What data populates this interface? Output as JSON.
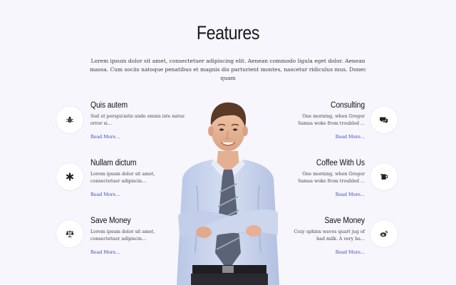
{
  "section": {
    "title": "Features",
    "intro": "Lorem ipsum dolor sit amet, consectetuer adipiscing elit. Aenean commodo ligula eget dolor. Aenean massa. Cum sociis natoque penatibus et magnis dis parturient montes, nascetur ridiculus mus. Donec quam"
  },
  "features_left": [
    {
      "title": "Quis autem",
      "text": "Sed ut perspiciatis unde omnis iste natus error si...",
      "link": "Read More...",
      "icon": "bug-icon"
    },
    {
      "title": "Nullam dictum",
      "text": "Lorem ipsum dolor sit amet, consectetuer adipiscin...",
      "link": "Read More...",
      "icon": "asterisk-icon"
    },
    {
      "title": "Save Money",
      "text": "Lorem ipsum dolor sit amet, consectetuer adipiscin...",
      "link": "Read More...",
      "icon": "balance-scale-icon"
    }
  ],
  "features_right": [
    {
      "title": "Consulting",
      "text": "One morning, when Gregor Samsa woke from troubled ...",
      "link": "Read More...",
      "icon": "comments-icon"
    },
    {
      "title": "Coffee With Us",
      "text": "One morning, when Gregor Samsa woke from troubled ...",
      "link": "Read More...",
      "icon": "coffee-cup-icon"
    },
    {
      "title": "Save Money",
      "text": "Cozy sphinx waves quart jug of bad milk. A very ba...",
      "link": "Read More...",
      "icon": "weibo-icon"
    }
  ],
  "colors": {
    "background": "#f7f6fc",
    "link": "#3b4bc4",
    "heading": "#111111"
  }
}
